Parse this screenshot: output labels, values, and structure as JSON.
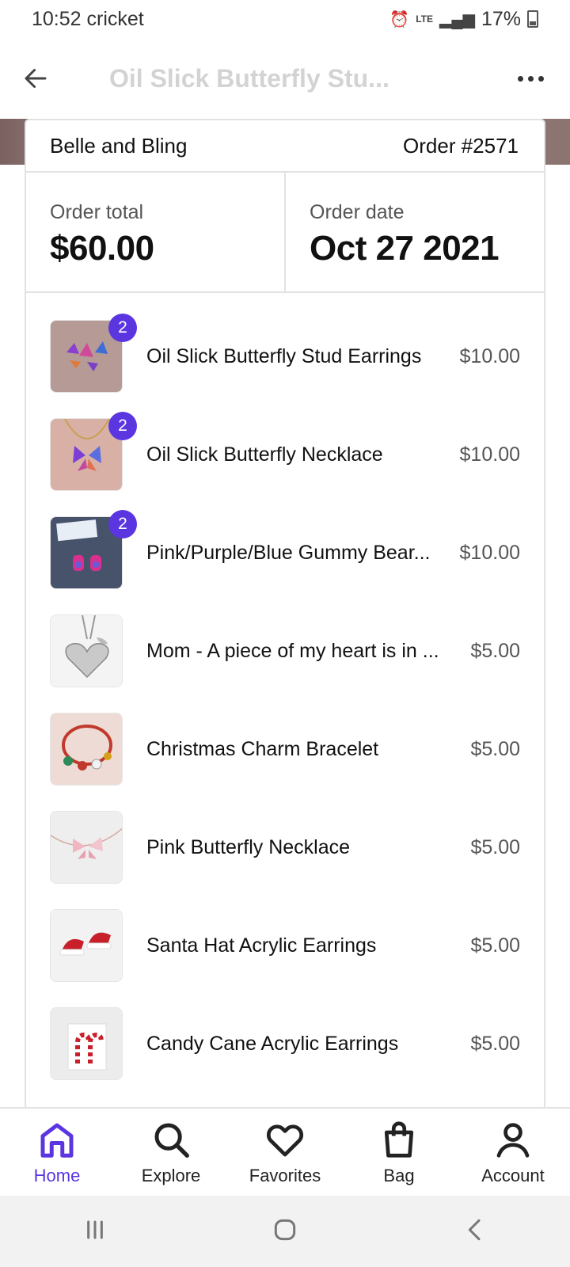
{
  "status": {
    "time_carrier": "10:52 cricket",
    "lte": "LTE",
    "battery": "17%"
  },
  "app_bar": {
    "title": "Oil Slick Butterfly Stu..."
  },
  "order": {
    "shop": "Belle and Bling",
    "number": "Order #2571",
    "total_label": "Order total",
    "total_value": "$60.00",
    "date_label": "Order date",
    "date_value": "Oct 27 2021"
  },
  "items": [
    {
      "name": "Oil Slick Butterfly Stud Earrings",
      "price": "$10.00",
      "qty": "2",
      "thumb": "butterfly-earrings-thumbnail"
    },
    {
      "name": "Oil Slick Butterfly Necklace",
      "price": "$10.00",
      "qty": "2",
      "thumb": "butterfly-necklace-thumbnail"
    },
    {
      "name": "Pink/Purple/Blue Gummy Bear...",
      "price": "$10.00",
      "qty": "2",
      "thumb": "gummy-bear-earrings-thumbnail"
    },
    {
      "name": "Mom - A piece of my heart is in ...",
      "price": "$5.00",
      "qty": "",
      "thumb": "heart-necklace-thumbnail"
    },
    {
      "name": "Christmas Charm Bracelet",
      "price": "$5.00",
      "qty": "",
      "thumb": "charm-bracelet-thumbnail"
    },
    {
      "name": "Pink Butterfly Necklace",
      "price": "$5.00",
      "qty": "",
      "thumb": "pink-butterfly-thumbnail"
    },
    {
      "name": "Santa Hat Acrylic Earrings",
      "price": "$5.00",
      "qty": "",
      "thumb": "santa-hat-thumbnail"
    },
    {
      "name": "Candy Cane Acrylic Earrings",
      "price": "$5.00",
      "qty": "",
      "thumb": "candy-cane-thumbnail"
    }
  ],
  "nav": {
    "home": "Home",
    "explore": "Explore",
    "favorites": "Favorites",
    "bag": "Bag",
    "account": "Account"
  },
  "colors": {
    "accent": "#5a35e0"
  }
}
